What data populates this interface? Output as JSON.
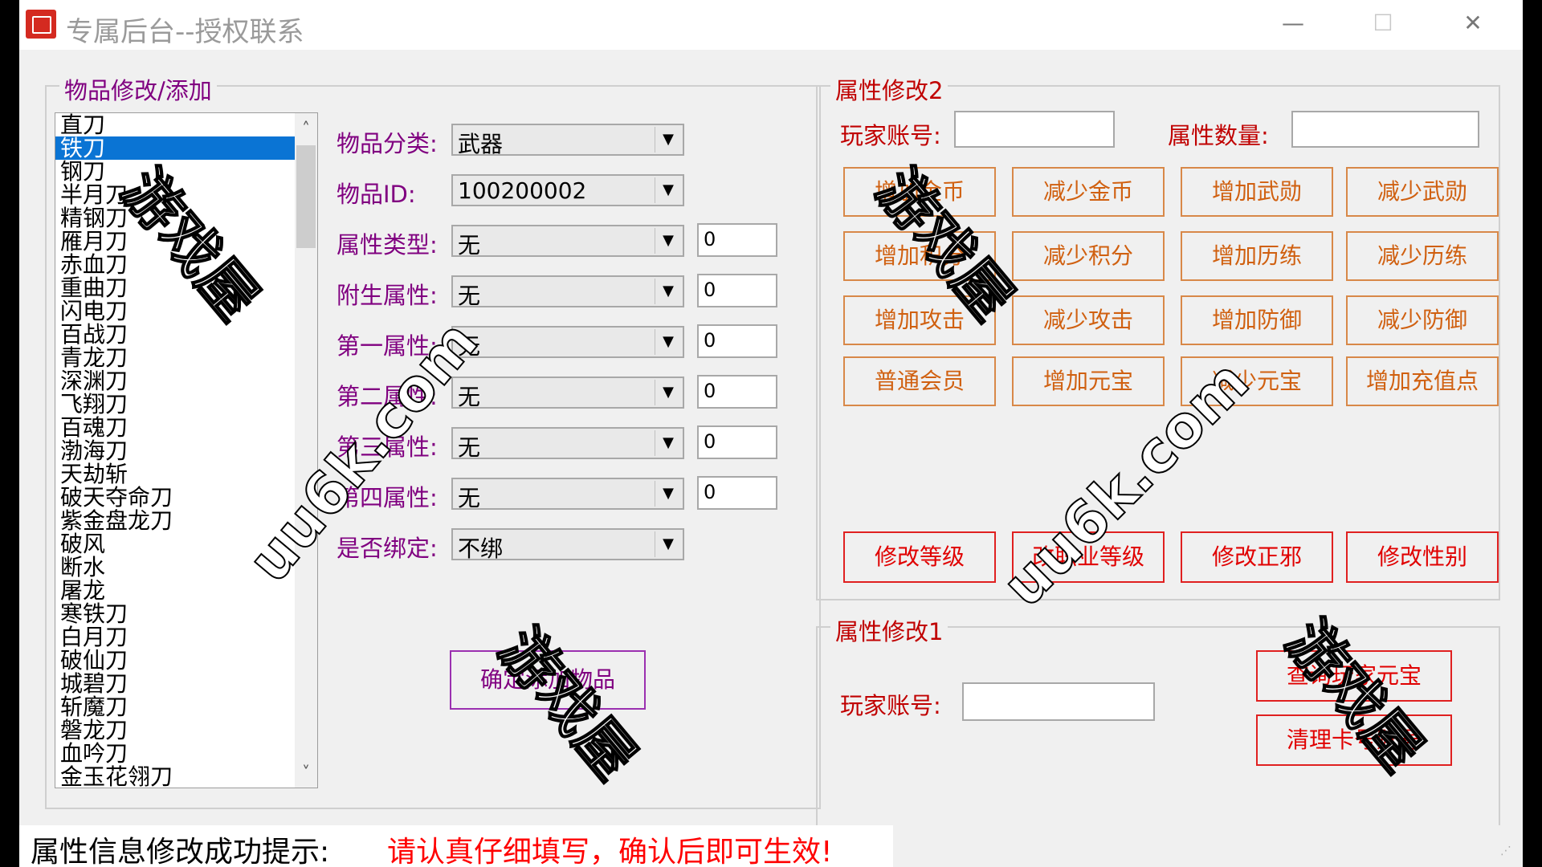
{
  "window": {
    "title": "专属后台--授权联系",
    "minimize_glyph": "—",
    "maximize_glyph": "☐",
    "close_glyph": "✕"
  },
  "item_panel": {
    "title": "物品修改/添加",
    "items": [
      "直刀",
      "铁刀",
      "钢刀",
      "半月刀",
      "精钢刀",
      "雁月刀",
      "赤血刀",
      "重曲刀",
      "闪电刀",
      "百战刀",
      "青龙刀",
      "深渊刀",
      "飞翔刀",
      "百魂刀",
      "渤海刀",
      "天劫斩",
      "破天夺命刀",
      "紫金盘龙刀",
      "破风",
      "断水",
      "屠龙",
      "寒铁刀",
      "白月刀",
      "破仙刀",
      "城碧刀",
      "斩魔刀",
      "磐龙刀",
      "血吟刀",
      "金玉花翎刀"
    ],
    "selected_index": 1,
    "scroll_up_glyph": "˄",
    "scroll_down_glyph": "˅",
    "fields": [
      {
        "label": "物品分类:",
        "value": "武器",
        "number": null
      },
      {
        "label": "物品ID:",
        "value": "100200002",
        "number": null
      },
      {
        "label": "属性类型:",
        "value": "无",
        "number": "0"
      },
      {
        "label": "附生属性:",
        "value": "无",
        "number": "0"
      },
      {
        "label": "第一属性:",
        "value": "无",
        "number": "0"
      },
      {
        "label": "第二属性:",
        "value": "无",
        "number": "0"
      },
      {
        "label": "第三属性:",
        "value": "无",
        "number": "0"
      },
      {
        "label": "第四属性:",
        "value": "无",
        "number": "0"
      },
      {
        "label": "是否绑定:",
        "value": "不绑",
        "number": null
      }
    ],
    "dropdown_glyph": "▼",
    "add_button": "确定添加物品"
  },
  "attr2_panel": {
    "title": "属性修改2",
    "player_label": "玩家账号:",
    "player_value": "",
    "count_label": "属性数量:",
    "count_value": "",
    "buttons": [
      "增加金币",
      "减少金币",
      "增加武勋",
      "减少武勋",
      "增加积分",
      "减少积分",
      "增加历练",
      "减少历练",
      "增加攻击",
      "减少攻击",
      "增加防御",
      "减少防御",
      "普通会员",
      "增加元宝",
      "减少元宝",
      "增加充值点"
    ],
    "red_buttons": [
      "修改等级",
      "改职业等级",
      "修改正邪",
      "修改性别"
    ]
  },
  "attr1_panel": {
    "title": "属性修改1",
    "player_label": "玩家账号:",
    "player_value": "",
    "query_button": "查询玩家元宝",
    "clear_button": "清理卡号账号"
  },
  "status": {
    "label": "属性信息修改成功提示:",
    "message": "请认真仔细填写，确认后即可生效!"
  },
  "watermarks": [
    "游戏屋",
    "uu6k.com"
  ],
  "colors": {
    "purple": "#800080",
    "red": "#c00000",
    "orange": "#d06010",
    "selection": "#0a74d4"
  }
}
